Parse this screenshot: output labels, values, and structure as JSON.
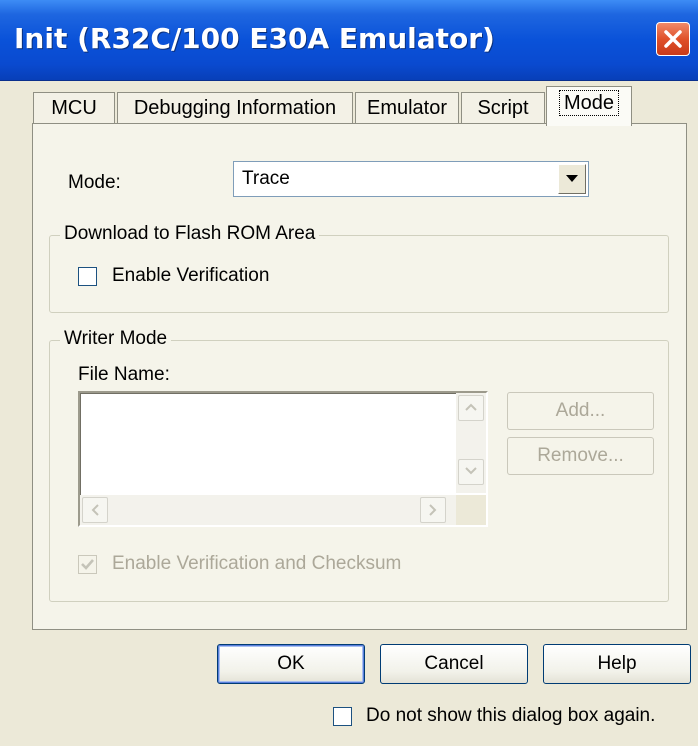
{
  "window": {
    "title": "Init (R32C/100 E30A Emulator)"
  },
  "tabs": [
    {
      "label": "MCU"
    },
    {
      "label": "Debugging Information"
    },
    {
      "label": "Emulator"
    },
    {
      "label": "Script"
    },
    {
      "label": "Mode",
      "selected": true
    }
  ],
  "mode": {
    "label": "Mode:",
    "value": "Trace"
  },
  "download_group": {
    "title": "Download to Flash ROM Area",
    "enable_verification": {
      "label": "Enable Verification",
      "checked": false
    }
  },
  "writer_group": {
    "title": "Writer Mode",
    "file_name_label": "File Name:",
    "files": [],
    "add_label": "Add...",
    "remove_label": "Remove...",
    "checksum": {
      "label": "Enable Verification and Checksum",
      "checked": true,
      "enabled": false
    }
  },
  "buttons": {
    "ok": "OK",
    "cancel": "Cancel",
    "help": "Help"
  },
  "do_not_show": {
    "label": "Do not show this dialog box again.",
    "checked": false
  },
  "colors": {
    "title_bar": "#0a52d9",
    "close_button": "#e0512a",
    "dialog_bg": "#ece9d8"
  }
}
